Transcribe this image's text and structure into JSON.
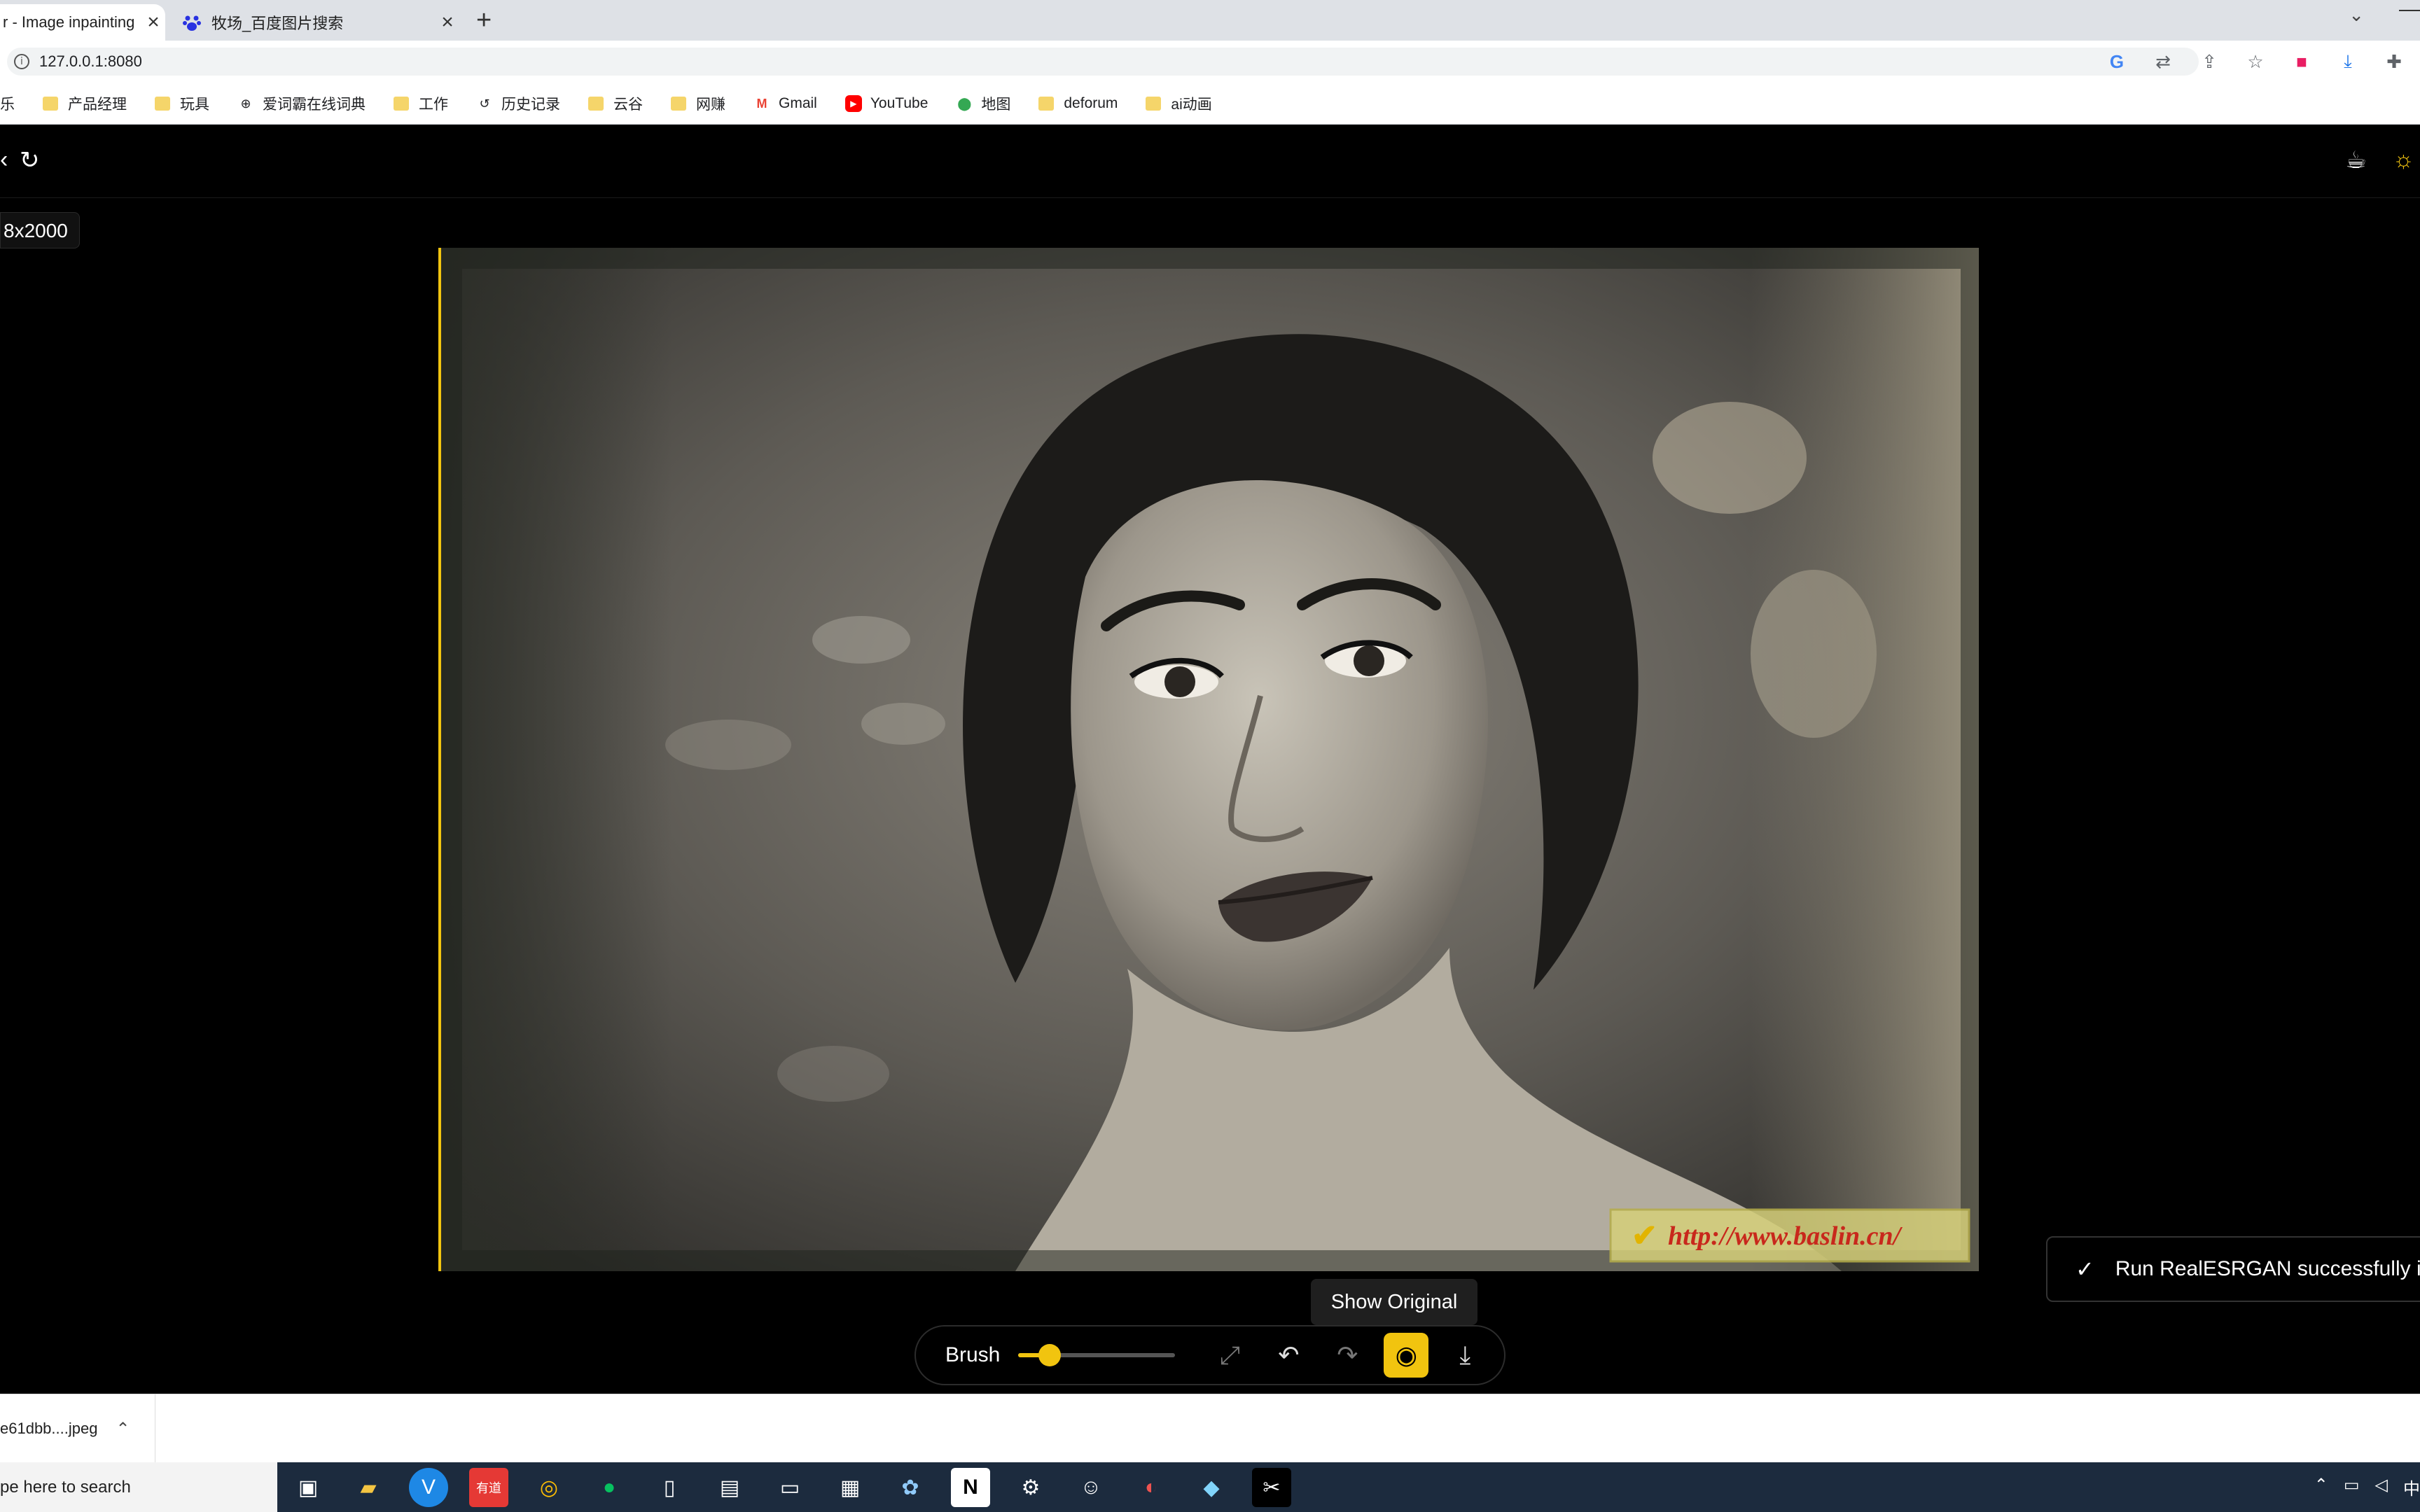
{
  "browser": {
    "tabs": [
      {
        "title": "r - Image inpainting",
        "active": true
      },
      {
        "title": "牧场_百度图片搜索",
        "active": false
      }
    ],
    "new_tab": "+",
    "address": "127.0.0.1:8080",
    "bookmarks": [
      "乐",
      "产品经理",
      "玩具",
      "爱词霸在线词典",
      "工作",
      "历史记录",
      "云谷",
      "网赚",
      "Gmail",
      "YouTube",
      "地图",
      "deforum",
      "ai动画"
    ]
  },
  "app": {
    "image_dims": "8x2000",
    "tooltip": "Show Original",
    "toast": "Run RealESRGAN successfully in",
    "toolbar": {
      "brush_label": "Brush",
      "brush_level": 0.2
    },
    "watermark": "http://www.baslin.cn/"
  },
  "downloads": {
    "file": "e61dbb....jpeg"
  },
  "taskbar": {
    "search_placeholder": "pe here to search",
    "lang": "中"
  },
  "colors": {
    "accent": "#f1c40f"
  }
}
